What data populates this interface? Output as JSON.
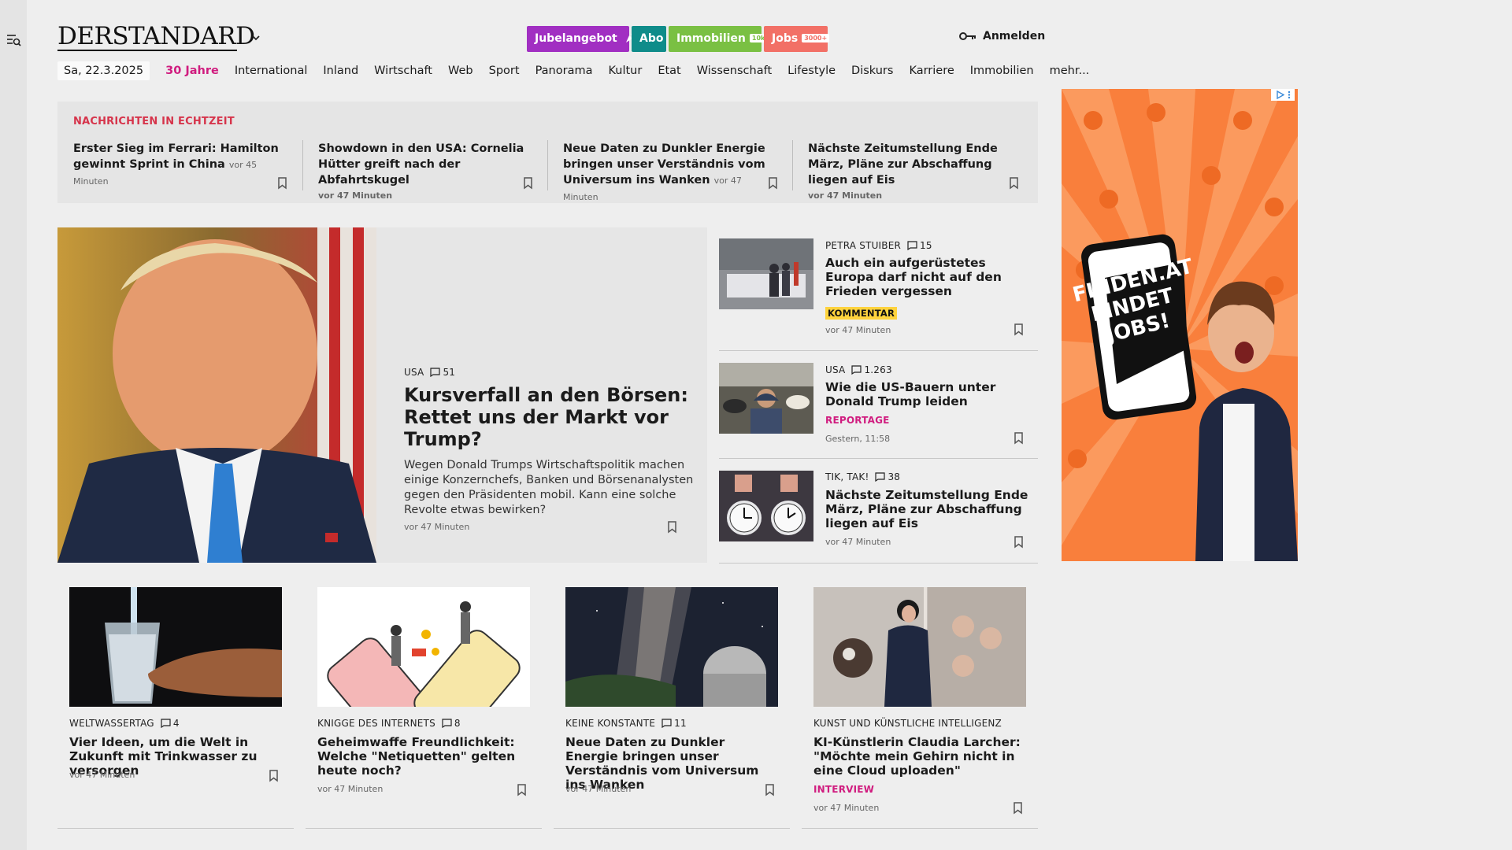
{
  "header": {
    "logo_text": "DERSTANDARD",
    "promos": [
      {
        "label": "Jubelangebot",
        "color": "#a12fc2"
      },
      {
        "label": "Abo",
        "color": "#0f8c8a"
      },
      {
        "label": "Immobilien",
        "tag": "10k+",
        "color": "#7ac043"
      },
      {
        "label": "Jobs",
        "tag": "3000+",
        "color": "#f27066"
      }
    ],
    "login_label": "Anmelden"
  },
  "nav": {
    "date": "Sa, 22.3.2025",
    "items": [
      "30 Jahre",
      "International",
      "Inland",
      "Wirtschaft",
      "Web",
      "Sport",
      "Panorama",
      "Kultur",
      "Etat",
      "Wissenschaft",
      "Lifestyle",
      "Diskurs",
      "Karriere",
      "Immobilien",
      "mehr..."
    ]
  },
  "realtime": {
    "heading": "NACHRICHTEN IN ECHTZEIT",
    "items": [
      {
        "title": "Erster Sieg im Ferrari: Hamilton gewinnt Sprint in China",
        "time": "vor 45 Minuten"
      },
      {
        "title": "Showdown in den USA: Cornelia Hütter greift nach der Abfahrtskugel",
        "time": "vor 47 Minuten"
      },
      {
        "title": "Neue Daten zu Dunkler Energie bringen unser Verständnis vom Universum ins Wanken",
        "time": "vor 47 Minuten"
      },
      {
        "title": "Nächste Zeitumstellung Ende März, Pläne zur Abschaffung liegen auf Eis",
        "time": "vor 47 Minuten"
      }
    ]
  },
  "hero": {
    "kicker": "USA",
    "comments": "51",
    "title": "Kursverfall an den Börsen: Rettet uns der Markt vor Trump?",
    "lead": "Wegen Donald Trumps Wirtschaftspolitik machen einige Konzernchefs, Banken und Börsenanalysten gegen den Präsidenten mobil. Kann eine solche Revolte etwas bewirken?",
    "time": "vor 47 Minuten"
  },
  "side": [
    {
      "kicker": "PETRA STUIBER",
      "comments": "15",
      "title": "Auch ein aufgerüstetes Europa darf nicht auf den Frieden vergessen",
      "label": "KOMMENTAR",
      "time": "vor 47 Minuten"
    },
    {
      "kicker": "USA",
      "comments": "1.263",
      "title": "Wie die US-Bauern unter Donald Trump leiden",
      "label": "REPORTAGE",
      "time": "Gestern, 11:58"
    },
    {
      "kicker": "TIK, TAK!",
      "comments": "38",
      "title": "Nächste Zeitumstellung Ende März, Pläne zur Abschaffung liegen auf Eis",
      "time": "vor 47 Minuten"
    }
  ],
  "ad": {
    "text_lines": [
      "FINDEN.AT",
      "FINDET",
      "JOBS!"
    ],
    "bg_color": "#f97f3c"
  },
  "cards": [
    {
      "kicker": "WELTWASSERTAG",
      "comments": "4",
      "title": "Vier Ideen, um die Welt in Zukunft mit Trinkwasser zu versorgen",
      "time": "vor 47 Minuten"
    },
    {
      "kicker": "KNIGGE DES INTERNETS",
      "comments": "8",
      "title": "Geheimwaffe Freundlichkeit: Welche \"Netiquetten\" gelten heute noch?",
      "time": "vor 47 Minuten"
    },
    {
      "kicker": "KEINE KONSTANTE",
      "comments": "11",
      "title": "Neue Daten zu Dunkler Energie bringen unser Verständnis vom Universum ins Wanken",
      "time": "vor 47 Minuten"
    },
    {
      "kicker": "KUNST UND KÜNSTLICHE INTELLIGENZ",
      "comments": "",
      "title": "KI-Künstlerin Claudia Larcher: \"Möchte mein Gehirn nicht in eine Cloud uploaden\"",
      "label": "INTERVIEW",
      "time": "vor 47 Minuten"
    }
  ]
}
